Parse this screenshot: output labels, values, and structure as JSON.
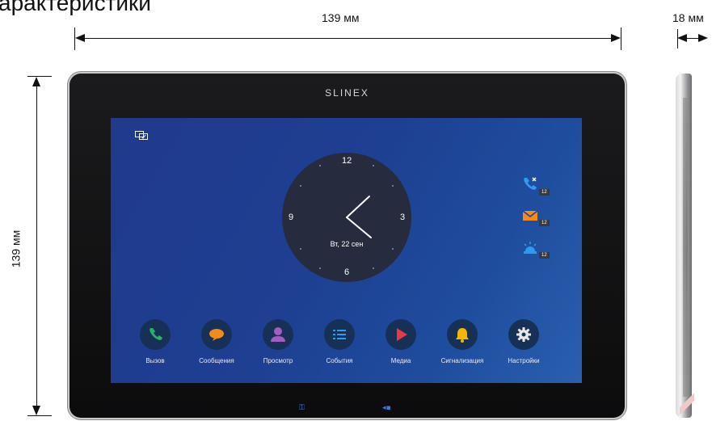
{
  "page": {
    "heading": "арактеристики",
    "width_label": "139 мм",
    "height_label": "139 мм",
    "depth_label": "18 мм"
  },
  "device": {
    "brand": "SLINEX",
    "clock": {
      "numbers": {
        "top": "12",
        "right": "3",
        "bottom": "6",
        "left": "9"
      },
      "date": "Вт, 22 сен"
    },
    "notifications": [
      {
        "icon": "missed-call-icon",
        "count": "12",
        "color": "#2d9bf0"
      },
      {
        "icon": "envelope-icon",
        "count": "12",
        "color": "#f28a1c"
      },
      {
        "icon": "alarm-light-icon",
        "count": "12",
        "color": "#2d9bf0"
      }
    ],
    "menu": [
      {
        "label": "Вызов",
        "icon": "phone-icon",
        "color": "#29b36a"
      },
      {
        "label": "Сообщения",
        "icon": "chat-bubble-icon",
        "color": "#f28a1c"
      },
      {
        "label": "Просмотр",
        "icon": "user-icon",
        "color": "#a05dc2"
      },
      {
        "label": "События",
        "icon": "list-icon",
        "color": "#2d9bf0"
      },
      {
        "label": "Медиа",
        "icon": "play-icon",
        "color": "#e63946"
      },
      {
        "label": "Сигнализация",
        "icon": "bell-icon",
        "color": "#f5b700"
      },
      {
        "label": "Настройки",
        "icon": "gear-icon",
        "color": "#e8e8e8"
      }
    ]
  }
}
